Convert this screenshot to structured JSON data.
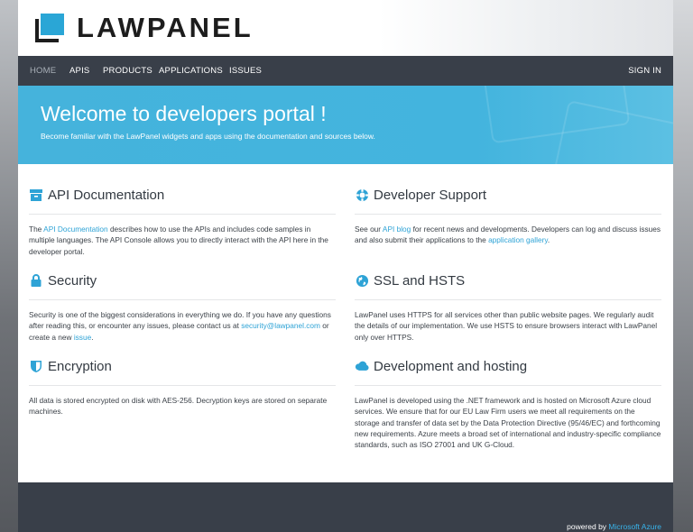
{
  "brand": {
    "name": "LAWPANEL"
  },
  "nav": {
    "items": [
      "HOME",
      "APIS",
      "PRODUCTS",
      "APPLICATIONS",
      "ISSUES"
    ],
    "sign_in": "SIGN IN"
  },
  "hero": {
    "title": "Welcome to developers portal !",
    "subtitle": "Become familiar with the LawPanel widgets and apps using the documentation and sources below."
  },
  "sections": {
    "api_docs": {
      "title": "API Documentation",
      "icon": "archive-icon",
      "t1": "The ",
      "link1": "API Documentation",
      "t2": " describes how to use the APIs and includes code samples in multiple languages. The API Console allows you to directly interact with the API here in the developer portal."
    },
    "support": {
      "title": "Developer Support",
      "icon": "lifebuoy-icon",
      "t1": "See our ",
      "link1": "API blog",
      "t2": " for recent news and developments. Developers can log and discuss issues and also submit their applications to the ",
      "link2": "application gallery",
      "t3": "."
    },
    "security": {
      "title": "Security",
      "icon": "lock-icon",
      "t1": "Security is one of the biggest considerations in everything we do. If you have any questions after reading this, or encounter any issues, please contact us at ",
      "link1": "security@lawpanel.com",
      "t2": " or create a new ",
      "link2": "issue",
      "t3": "."
    },
    "ssl": {
      "title": "SSL and HSTS",
      "icon": "globe-icon",
      "text": "LawPanel uses HTTPS for all services other than public website pages. We regularly audit the details of our implementation. We use HSTS to ensure browsers interact with LawPanel only over HTTPS."
    },
    "encryption": {
      "title": "Encryption",
      "icon": "shield-icon",
      "text": "All data is stored encrypted on disk with AES-256. Decryption keys are stored on separate machines."
    },
    "hosting": {
      "title": "Development and hosting",
      "icon": "cloud-icon",
      "text": "LawPanel is developed using the .NET framework and is hosted on Microsoft Azure cloud services. We ensure that for our EU Law Firm users we meet all requirements on the storage and transfer of data set by the Data Protection Directive (95/46/EC) and forthcoming new requirements. Azure meets a broad set of international and industry-specific compliance standards, such as ISO 27001 and UK G-Cloud."
    }
  },
  "footer": {
    "powered_by": "powered by ",
    "provider": "Microsoft Azure"
  },
  "colors": {
    "accent": "#2ea3d6",
    "nav_bg": "#393f49",
    "hero_bg": "#45b3dc"
  }
}
